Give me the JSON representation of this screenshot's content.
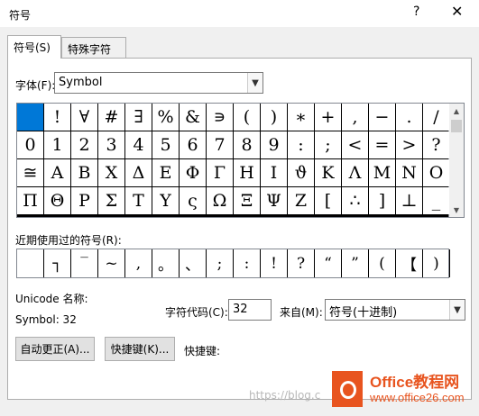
{
  "title": "符号",
  "help_glyph": "?",
  "close_glyph": "✕",
  "tabs": [
    {
      "label": "符号(S)"
    },
    {
      "label": "特殊字符(P)"
    }
  ],
  "font": {
    "label": "字体(F):",
    "value": "Symbol"
  },
  "symbols": [
    " ",
    "!",
    "∀",
    "#",
    "∃",
    "%",
    "&",
    "∍",
    "(",
    ")",
    "∗",
    "+",
    ",",
    "−",
    ".",
    "/",
    "0",
    "1",
    "2",
    "3",
    "4",
    "5",
    "6",
    "7",
    "8",
    "9",
    ":",
    ";",
    "<",
    "=",
    ">",
    "?",
    "≅",
    "Α",
    "Β",
    "Χ",
    "Δ",
    "Ε",
    "Φ",
    "Γ",
    "Η",
    "Ι",
    "ϑ",
    "Κ",
    "Λ",
    "Μ",
    "Ν",
    "Ο",
    "Π",
    "Θ",
    "Ρ",
    "Σ",
    "Τ",
    "Υ",
    "ς",
    "Ω",
    "Ξ",
    "Ψ",
    "Ζ",
    "[",
    "∴",
    "]",
    "⊥",
    "_"
  ],
  "recent_label": "近期使用过的符号(R):",
  "recent_symbols": [
    " ",
    "┐",
    "‾",
    "~",
    ",",
    "。",
    "、",
    ";",
    ":",
    "!",
    "?",
    "“",
    "”",
    "(",
    "【",
    ")"
  ],
  "unicode_name_label": "Unicode 名称:",
  "unicode_name_value": "Symbol: 32",
  "char_code": {
    "label": "字符代码(C):",
    "value": "32"
  },
  "from": {
    "label": "来自(M):",
    "value": "符号(十进制)"
  },
  "buttons": {
    "autocorrect": "自动更正(A)...",
    "shortcut_key": "快捷键(K)...",
    "shortcut_label": "快捷键:"
  },
  "watermark": "https://blog.c",
  "logo": {
    "title": "Office教程网",
    "url": "www.office26.com"
  },
  "colors": {
    "selection": "#0078d7",
    "logo": "#e8541f"
  }
}
